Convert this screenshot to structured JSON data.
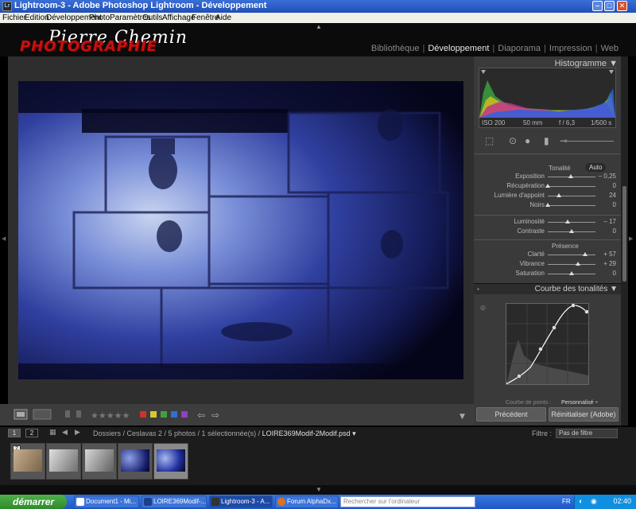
{
  "window": {
    "title": "Lightroom-3 - Adobe Photoshop Lightroom - Développement",
    "icon": "Lr"
  },
  "menu": [
    "Fichier",
    "Edition",
    "Développement",
    "Photo",
    "Paramètres",
    "Outils",
    "Affichage",
    "Fenêtre",
    "Aide"
  ],
  "logo": {
    "signature": "Pierre Chemin",
    "brand": "PHOTOGRAPHIE"
  },
  "modules": [
    "Bibliothèque",
    "Développement",
    "Diaporama",
    "Impression",
    "Web"
  ],
  "active_module": "Développement",
  "panel": {
    "histogram_title": "Histogramme ▼",
    "exif": {
      "iso": "ISO 200",
      "focal": "50 mm",
      "aperture": "f / 6,3",
      "shutter": "1/500 s"
    },
    "tonalite_label": "Tonalité",
    "auto_label": "Auto",
    "presence_label": "Présence",
    "sliders": [
      {
        "label": "Exposition",
        "value": "– 0,25",
        "pos": 0.48
      },
      {
        "label": "Récupération",
        "value": "0",
        "pos": 0.0
      },
      {
        "label": "Lumière d'appoint",
        "value": "24",
        "pos": 0.24
      },
      {
        "label": "Noirs",
        "value": "0",
        "pos": 0.0
      },
      {
        "label": "Luminosité",
        "value": "– 17",
        "pos": 0.42
      },
      {
        "label": "Contraste",
        "value": "0",
        "pos": 0.5
      },
      {
        "label": "Clarté",
        "value": "+ 57",
        "pos": 0.78
      },
      {
        "label": "Vibrance",
        "value": "+ 29",
        "pos": 0.64
      },
      {
        "label": "Saturation",
        "value": "0",
        "pos": 0.5
      }
    ],
    "curve_title": "Courbe des tonalités ▼",
    "curve_footer": "Courbe de points :",
    "curve_footer_value": "Personnalisé ÷",
    "prev_button": "Précédent",
    "reset_button": "Réinitialiser (Adobe)"
  },
  "filmstrip": {
    "page1": "1",
    "page2": "2",
    "breadcrumb": "Dossiers / Ceslavas 2 / 5 photos / 1 sélectionnée(s) /",
    "filename": "LOIRE369Modif-2Modif.psd ▾",
    "filter_label": "Filtre :",
    "filter_value": "Pas de filtre",
    "thumb_badge": "2"
  },
  "taskbar": {
    "start": "démarrer",
    "tasks": [
      "Document1 - Mi...",
      "LOIRE369Modif-...",
      "Lightroom-3 - A...",
      "Forum AlphaDx..."
    ],
    "search_placeholder": "Rechercher sur l'ordinateur",
    "lang": "FR",
    "clock": "02:40"
  },
  "colors": {
    "accent": "#e6e6e6",
    "panel": "#3a3a3a",
    "bg": "#2e2e2e",
    "logo_red": "#c81010",
    "taskbar": "#1e55c8"
  }
}
